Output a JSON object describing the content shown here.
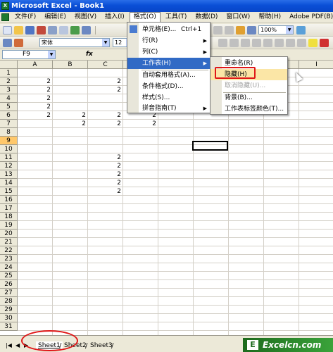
{
  "window": {
    "title": "Microsoft Excel - Book1",
    "icon": "excel-icon"
  },
  "menu": [
    {
      "label": "文件(F)"
    },
    {
      "label": "编辑(E)"
    },
    {
      "label": "视图(V)"
    },
    {
      "label": "插入(I)"
    },
    {
      "label": "格式(O)",
      "active": true
    },
    {
      "label": "工具(T)"
    },
    {
      "label": "数据(D)"
    },
    {
      "label": "窗口(W)"
    },
    {
      "label": "帮助(H)"
    },
    {
      "label": "Adobe PDF(B)"
    }
  ],
  "toolbar": {
    "zoom": "100%",
    "font": "宋体",
    "font_size": "12",
    "sigma": "Σ"
  },
  "formula_bar": {
    "name_box": "F9",
    "fx": "fx",
    "value": ""
  },
  "columns": [
    "A",
    "B",
    "C",
    "D",
    "E",
    "F",
    "G",
    "H",
    "I"
  ],
  "rows": [
    "1",
    "2",
    "3",
    "4",
    "5",
    "6",
    "7",
    "8",
    "9",
    "10",
    "11",
    "12",
    "13",
    "14",
    "15",
    "16",
    "17",
    "18",
    "19",
    "20",
    "21",
    "22",
    "23",
    "24",
    "25",
    "26",
    "27",
    "28",
    "29",
    "30",
    "31"
  ],
  "selected_row": "9",
  "selected_cell": "F9",
  "cells": [
    {
      "ref": "A2",
      "value": "2"
    },
    {
      "ref": "C2",
      "value": "2"
    },
    {
      "ref": "A3",
      "value": "2"
    },
    {
      "ref": "C3",
      "value": "2"
    },
    {
      "ref": "A4",
      "value": "2"
    },
    {
      "ref": "A5",
      "value": "2"
    },
    {
      "ref": "A6",
      "value": "2"
    },
    {
      "ref": "B6",
      "value": "2"
    },
    {
      "ref": "C6",
      "value": "2"
    },
    {
      "ref": "D6",
      "value": "2"
    },
    {
      "ref": "B7",
      "value": "2"
    },
    {
      "ref": "C7",
      "value": "2"
    },
    {
      "ref": "D7",
      "value": "2"
    },
    {
      "ref": "C11",
      "value": "2"
    },
    {
      "ref": "C12",
      "value": "2"
    },
    {
      "ref": "C13",
      "value": "2"
    },
    {
      "ref": "C14",
      "value": "2"
    },
    {
      "ref": "C15",
      "value": "2"
    }
  ],
  "format_menu": {
    "items": [
      {
        "label": "单元格(E)...",
        "shortcut": "Ctrl+1",
        "icon": "format-cells-icon"
      },
      {
        "label": "行(R)",
        "submenu": true
      },
      {
        "label": "列(C)",
        "submenu": true
      },
      {
        "label": "工作表(H)",
        "submenu": true,
        "highlighted": true
      },
      {
        "label": "自动套用格式(A)..."
      },
      {
        "label": "条件格式(D)..."
      },
      {
        "label": "样式(S)..."
      },
      {
        "label": "拼音指南(T)",
        "submenu": true
      }
    ]
  },
  "sheet_submenu": {
    "items": [
      {
        "label": "重命名(R)"
      },
      {
        "label": "隐藏(H)",
        "highlighted": true
      },
      {
        "label": "取消隐藏(U)...",
        "disabled": true
      },
      {
        "label": "背景(B)..."
      },
      {
        "label": "工作表标签颜色(T)..."
      }
    ]
  },
  "sheets": [
    {
      "label": "Sheet1",
      "active": true
    },
    {
      "label": "Sheet2"
    },
    {
      "label": "Sheet3"
    }
  ],
  "watermark": "Excelcn.com",
  "colors": {
    "title_bar": "#0a4fd6",
    "highlight": "#316ac5",
    "annotation": "#e01818",
    "selected_row": "#ffc86b"
  }
}
